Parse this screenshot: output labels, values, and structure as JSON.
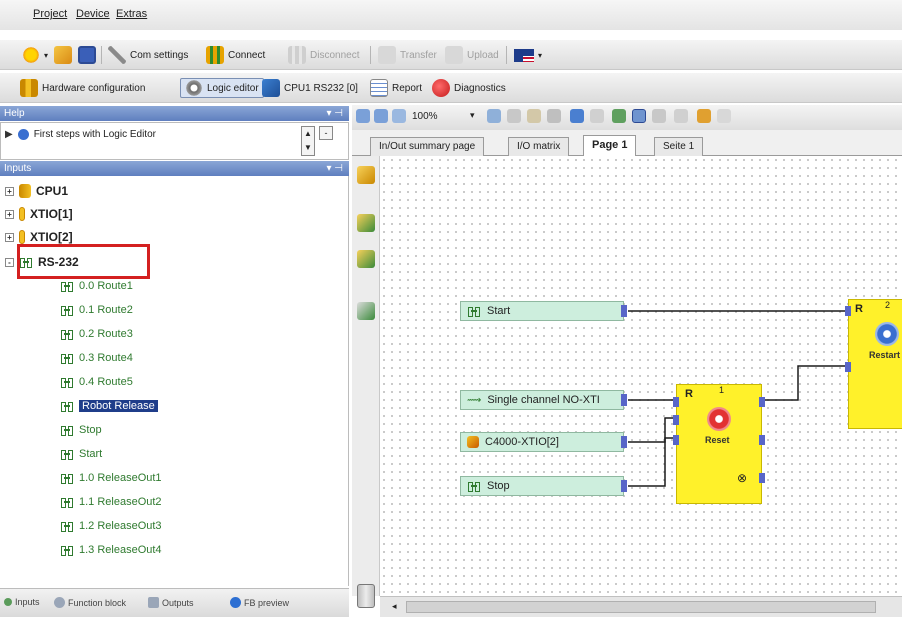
{
  "menu": [
    "Project",
    "Device",
    "Extras"
  ],
  "toolbar1": {
    "com_settings": "Com settings",
    "connect": "Connect",
    "disconnect": "Disconnect",
    "transfer": "Transfer",
    "upload": "Upload"
  },
  "toolbar2": {
    "hardware_configuration": "Hardware configuration",
    "logic_editor": "Logic editor",
    "cpu_port": "CPU1 RS232 [0]",
    "report": "Report",
    "diagnostics": "Diagnostics"
  },
  "help_panel": {
    "title": "Help",
    "item": "First steps with Logic Editor"
  },
  "inputs_panel": {
    "title": "Inputs",
    "roots": [
      {
        "label": "CPU1",
        "expander": "+"
      },
      {
        "label": "XTIO[1]",
        "expander": "+"
      },
      {
        "label": "XTIO[2]",
        "expander": "+"
      },
      {
        "label": "RS-232",
        "expander": "-"
      }
    ],
    "rs232_items": [
      "0.0 Route1",
      "0.1 Route2",
      "0.2 Route3",
      "0.3 Route4",
      "0.4 Route5",
      "Robot Release",
      "Stop",
      "Start",
      "1.0 ReleaseOut1",
      "1.1 ReleaseOut2",
      "1.2 ReleaseOut3",
      "1.3 ReleaseOut4"
    ]
  },
  "bottom_tabs": [
    "Inputs",
    "Function block",
    "Outputs",
    "FB preview"
  ],
  "editor_toolbar": {
    "zoom": "100%"
  },
  "page_tabs": [
    "In/Out summary page",
    "I/O matrix",
    "Page 1",
    "Seite 1"
  ],
  "canvas": {
    "signals": {
      "start": "Start",
      "single_channel": "Single channel NO-XTI",
      "c4000": "C4000-XTIO[2]",
      "stop": "Stop"
    },
    "block_reset": {
      "type": "R",
      "number": "1",
      "label": "Reset"
    },
    "block_restart": {
      "type": "R",
      "number": "2",
      "label": "Restart"
    }
  }
}
